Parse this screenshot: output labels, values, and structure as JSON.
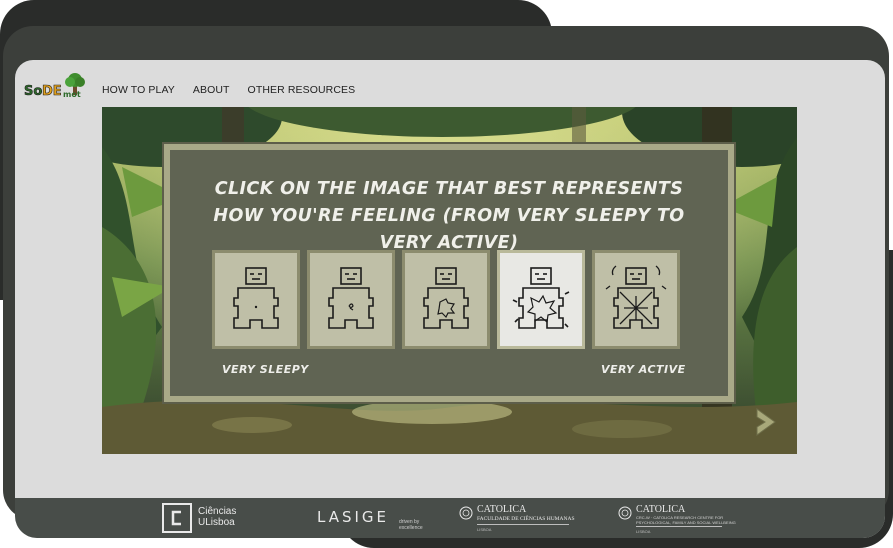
{
  "header": {
    "logo_text": "SoDEmot",
    "nav": [
      "HOW TO PLAY",
      "ABOUT",
      "OTHER RESOURCES"
    ]
  },
  "game": {
    "prompt": "Click on the image that best represents how you're feeling (from very sleepy to very active)",
    "options": [
      {
        "id": "level-1",
        "selected": false
      },
      {
        "id": "level-2",
        "selected": false
      },
      {
        "id": "level-3",
        "selected": false
      },
      {
        "id": "level-4",
        "selected": true
      },
      {
        "id": "level-5",
        "selected": false
      }
    ],
    "min_label": "VERY SLEEPY",
    "max_label": "VERY ACTIVE",
    "next_icon": "chevron-right-icon"
  },
  "footer": {
    "ciencias_line1": "Ciências",
    "ciencias_line2": "ULisboa",
    "lasige_name": "LASIGE",
    "lasige_tag1": "driven by",
    "lasige_tag2": "excellence",
    "catolica1_name": "CATOLICA",
    "catolica1_sub": "FACULDADE DE CIÊNCIAS HUMANAS",
    "catolica1_city": "LISBOA",
    "catolica2_name": "CATOLICA",
    "catolica2_sub1": "CRC-W · CATOLICA RESEARCH CENTRE FOR",
    "catolica2_sub2": "PSYCHOLOGICAL, FAMILY AND SOCIAL WELLBEING",
    "catolica2_city": "LISBOA"
  },
  "colors": {
    "panel": "#606453",
    "panel_border": "#a9a988",
    "option_bg": "#bfbfa7",
    "option_selected_bg": "#e8e8e4",
    "footer_bg": "#484d49",
    "arrow": "#a8a87a"
  }
}
